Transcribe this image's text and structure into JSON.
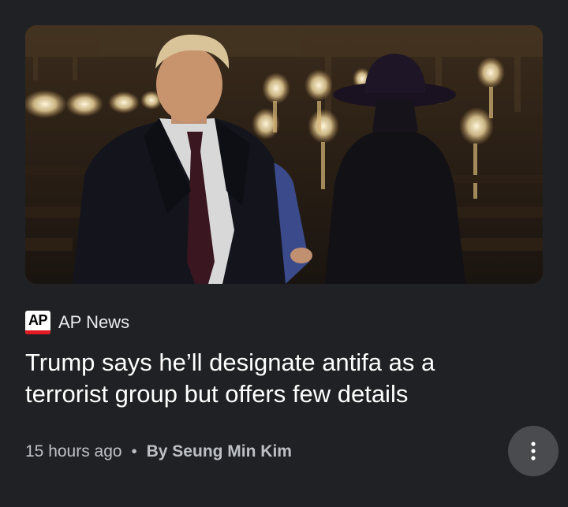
{
  "article": {
    "image_alt": "Two people in dark clothing walking in a dimly lit chapel with candles",
    "source": {
      "logo_text": "AP",
      "name": "AP News"
    },
    "headline": "Trump says he’ll designate antifa as a terrorist group but offers few details",
    "meta": {
      "time_ago": "15 hours ago",
      "separator": "•",
      "author": "By Seung Min Kim"
    },
    "more_icon": "more-vert-icon"
  },
  "colors": {
    "background": "#202124",
    "headline": "#ffffff",
    "meta": "#bdc1c6",
    "logo_red": "#e21b22",
    "more_button": "#4a4b4e"
  }
}
